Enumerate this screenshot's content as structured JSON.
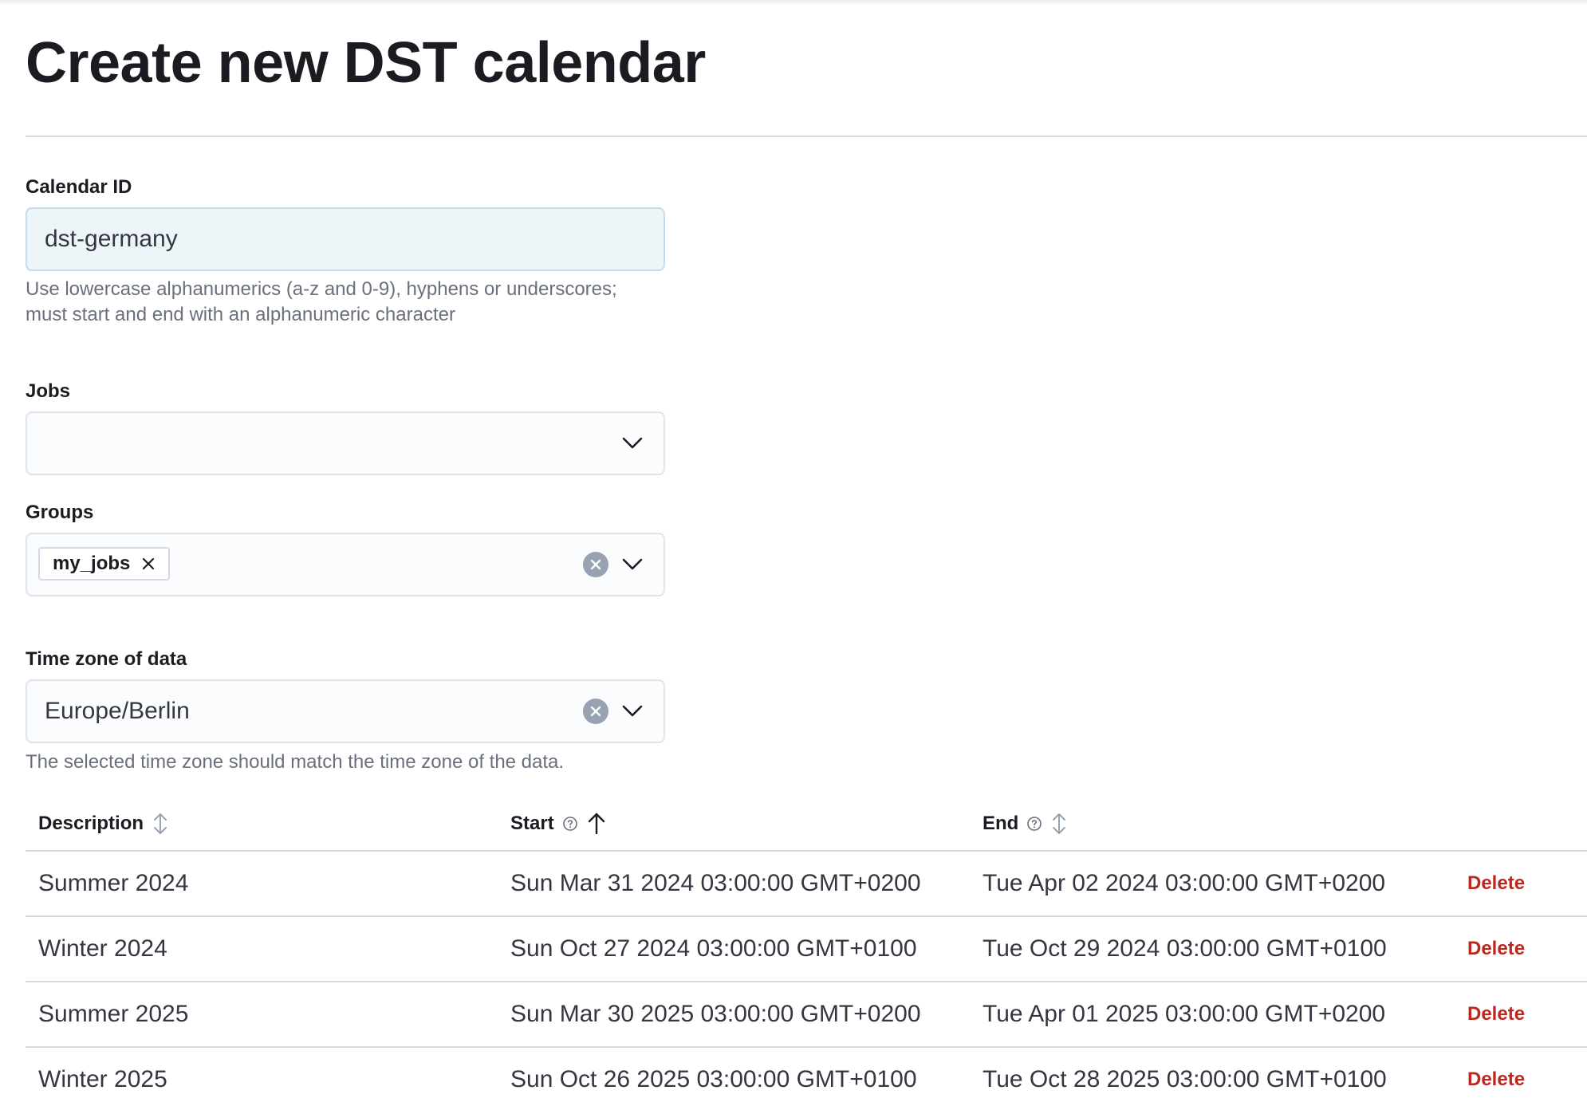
{
  "page": {
    "title": "Create new DST calendar"
  },
  "calendar_id": {
    "label": "Calendar ID",
    "value": "dst-germany",
    "help_line1": "Use lowercase alphanumerics (a-z and 0-9), hyphens or underscores;",
    "help_line2": "must start and end with an alphanumeric character"
  },
  "jobs": {
    "label": "Jobs",
    "value": ""
  },
  "groups": {
    "label": "Groups",
    "selected": [
      "my_jobs"
    ]
  },
  "time_zone": {
    "label": "Time zone of data",
    "value": "Europe/Berlin",
    "help": "The selected time zone should match the time zone of the data."
  },
  "table": {
    "headers": {
      "description": "Description",
      "start": "Start",
      "end": "End"
    },
    "sort": {
      "column": "start",
      "direction": "ascending"
    },
    "delete_label": "Delete",
    "rows": [
      {
        "description": "Summer 2024",
        "start": "Sun Mar 31 2024 03:00:00 GMT+0200",
        "end": "Tue Apr 02 2024 03:00:00 GMT+0200"
      },
      {
        "description": "Winter 2024",
        "start": "Sun Oct 27 2024 03:00:00 GMT+0100",
        "end": "Tue Oct 29 2024 03:00:00 GMT+0100"
      },
      {
        "description": "Summer 2025",
        "start": "Sun Mar 30 2025 03:00:00 GMT+0200",
        "end": "Tue Apr 01 2025 03:00:00 GMT+0200"
      },
      {
        "description": "Winter 2025",
        "start": "Sun Oct 26 2025 03:00:00 GMT+0100",
        "end": "Tue Oct 28 2025 03:00:00 GMT+0100"
      }
    ]
  },
  "colors": {
    "title_text": "#1a1c21",
    "help_text": "#69707d",
    "delete_link": "#bd271e",
    "input_active_bg": "#eef5f9",
    "input_bg": "#fbfcfd",
    "border": "#d3dae6"
  }
}
